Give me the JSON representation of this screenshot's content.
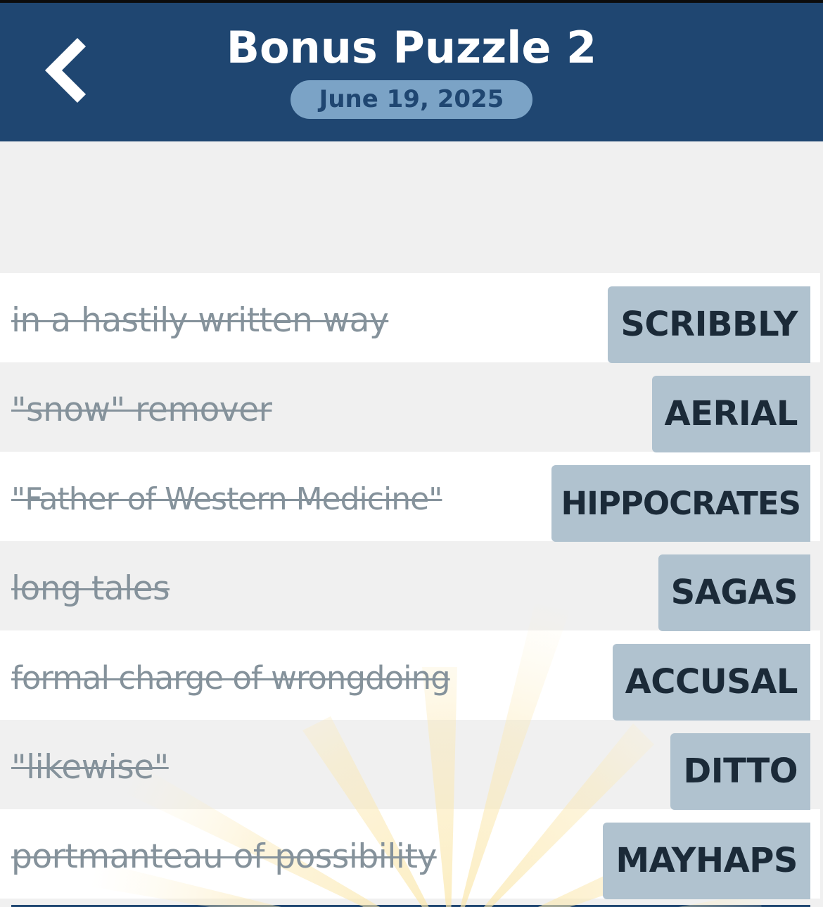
{
  "header": {
    "back_icon": "chevron-left-icon",
    "title": "Bonus Puzzle 2",
    "date": "June 19, 2025"
  },
  "colors": {
    "header_bg": "#1f4671",
    "date_pill_bg": "#7ba3c6",
    "answer_tile_bg": "#b0c2cf",
    "clue_text": "#85929b",
    "answer_text": "#1b2a38"
  },
  "clues": [
    {
      "clue": "in a hastily written way",
      "answer": "SCRIBBLY"
    },
    {
      "clue": "\"snow\" remover",
      "answer": "AERIAL"
    },
    {
      "clue": "\"Father of Western Medicine\"",
      "answer": "HIPPOCRATES"
    },
    {
      "clue": "long tales",
      "answer": "SAGAS"
    },
    {
      "clue": "formal charge of wrongdoing",
      "answer": "ACCUSAL"
    },
    {
      "clue": "\"likewise\"",
      "answer": "DITTO"
    },
    {
      "clue": "portmanteau of possibility",
      "answer": "MAYHAPS"
    }
  ]
}
